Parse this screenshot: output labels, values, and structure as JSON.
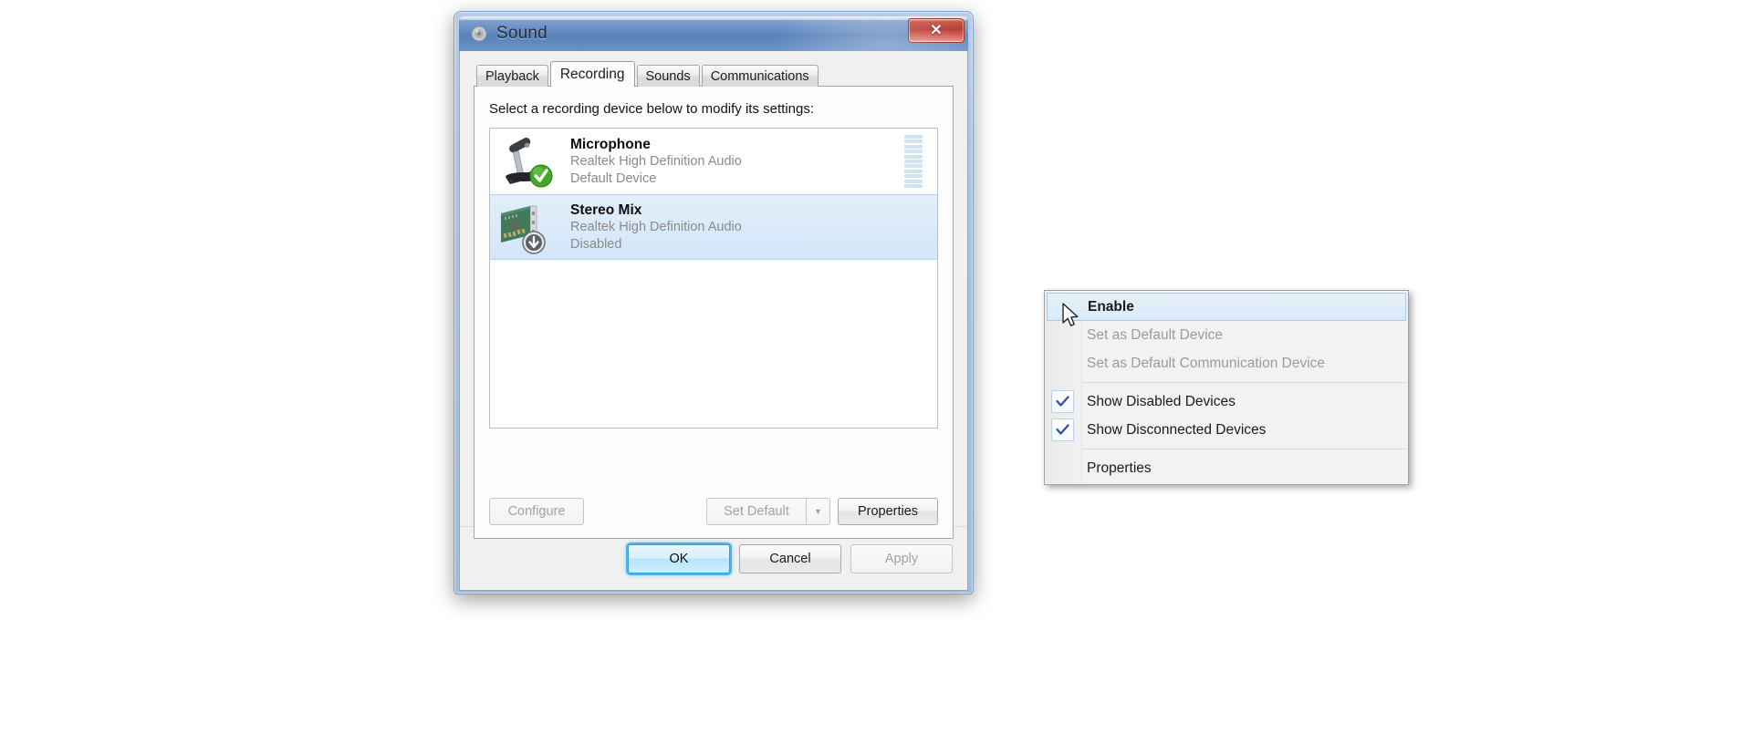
{
  "window": {
    "title": "Sound",
    "icon": "speaker-icon",
    "close_label": "✕"
  },
  "tabs": [
    {
      "label": "Playback",
      "active": false
    },
    {
      "label": "Recording",
      "active": true
    },
    {
      "label": "Sounds",
      "active": false
    },
    {
      "label": "Communications",
      "active": false
    }
  ],
  "panel": {
    "instruction": "Select a recording device below to modify its settings:"
  },
  "devices": [
    {
      "name": "Microphone",
      "driver": "Realtek High Definition Audio",
      "status": "Default Device",
      "icon": "microphone-icon",
      "badge": "check-badge",
      "selected": false,
      "meter_segments": 11
    },
    {
      "name": "Stereo Mix",
      "driver": "Realtek High Definition Audio",
      "status": "Disabled",
      "icon": "sound-card-icon",
      "badge": "disabled-badge",
      "selected": true,
      "meter_segments": 0
    }
  ],
  "panel_buttons": {
    "configure": {
      "label": "Configure",
      "disabled": true
    },
    "set_default": {
      "label": "Set Default",
      "disabled": true
    },
    "set_default_arrow": "▼",
    "properties": {
      "label": "Properties",
      "disabled": false
    }
  },
  "dialog_buttons": {
    "ok": "OK",
    "cancel": "Cancel",
    "apply": "Apply"
  },
  "context_menu": {
    "items": [
      {
        "label": "Enable",
        "state": "highlighted",
        "bold": true
      },
      {
        "label": "Set as Default Device",
        "state": "disabled"
      },
      {
        "label": "Set as Default Communication Device",
        "state": "disabled"
      },
      {
        "label": "Show Disabled Devices",
        "state": "checked"
      },
      {
        "label": "Show Disconnected Devices",
        "state": "checked"
      },
      {
        "label": "Properties",
        "state": "normal"
      }
    ]
  },
  "colors": {
    "titlebar_blue": "#5d84bd",
    "close_red": "#a92b22",
    "selection_blue": "#d4e6f9",
    "check_blue": "#2b4ea8",
    "ok_glow": "#4ab4ec",
    "green_badge": "#3faa23"
  }
}
